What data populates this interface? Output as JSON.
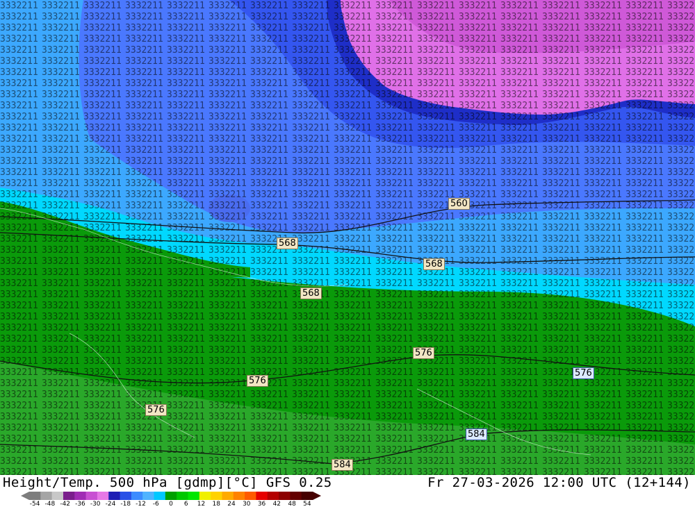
{
  "map": {
    "contour_labels": [
      "560",
      "568",
      "568",
      "568",
      "576",
      "576",
      "576",
      "576",
      "584",
      "584"
    ],
    "field_digits_hint": "temperature digits drawn as texture"
  },
  "footer": {
    "title_left": "Height/Temp. 500 hPa [gdmp][°C] GFS 0.25",
    "title_right": "Fr 27-03-2026 12:00 UTC (12+144)"
  },
  "colorbar": {
    "ticks": [
      "-54",
      "-48",
      "-42",
      "-36",
      "-30",
      "-24",
      "-18",
      "-12",
      "-6",
      "0",
      "6",
      "12",
      "18",
      "24",
      "30",
      "36",
      "42",
      "48",
      "54"
    ],
    "colors": [
      "#7d7d7d",
      "#a5a5a5",
      "#c8c8c8",
      "#7a1e8c",
      "#a02cb4",
      "#c850d2",
      "#e678e6",
      "#1e1eb4",
      "#2850e6",
      "#3c8cff",
      "#50b4ff",
      "#00c8ff",
      "#00a000",
      "#00c800",
      "#00e600",
      "#f0f000",
      "#ffd200",
      "#ffaa00",
      "#ff8200",
      "#ff5a00",
      "#e60000",
      "#b40000",
      "#8c0000",
      "#640000",
      "#460000"
    ]
  }
}
